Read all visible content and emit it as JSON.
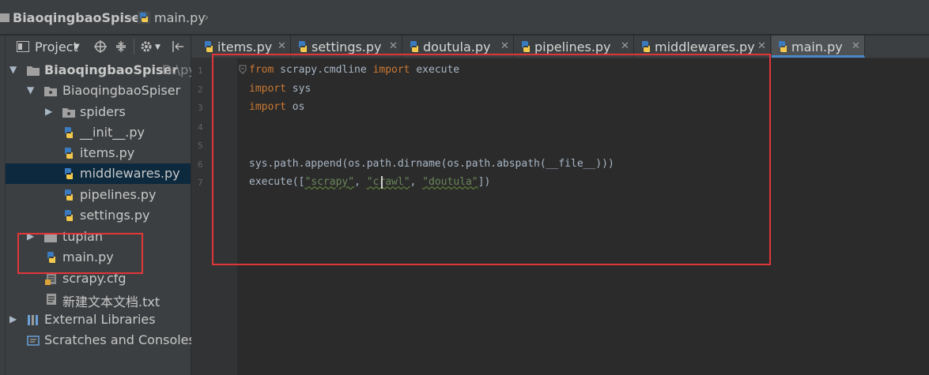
{
  "breadcrumb": {
    "project": "BiaoqingbaoSpiser",
    "file": "main.py"
  },
  "project_toolbar": {
    "title": "Project"
  },
  "tree": {
    "root": {
      "name": "BiaoqingbaoSpiser",
      "path": "D:\\py"
    },
    "package": "BiaoqingbaoSpiser",
    "spiders": "spiders",
    "init": "__init__.py",
    "items": "items.py",
    "middlewares": "middlewares.py",
    "pipelines": "pipelines.py",
    "settings": "settings.py",
    "tuplan": "tuplan",
    "main": "main.py",
    "scrapy_cfg": "scrapy.cfg",
    "txt": "新建文本文档.txt",
    "external": "External Libraries",
    "scratches": "Scratches and Consoles"
  },
  "tabs": [
    "items.py",
    "settings.py",
    "doutula.py",
    "pipelines.py",
    "middlewares.py",
    "main.py"
  ],
  "active_tab": "main.py",
  "editor": {
    "line_numbers": [
      "1",
      "2",
      "3",
      "4",
      "5",
      "6",
      "7"
    ],
    "l1": {
      "kw1": "from",
      "mid": " scrapy.cmdline ",
      "kw2": "import",
      "end": " execute"
    },
    "l2": {
      "kw": "import",
      "end": " sys"
    },
    "l3": {
      "kw": "import",
      "end": " os"
    },
    "l6": "sys.path.append(os.path.dirname(os.path.abspath(__file__)))",
    "l7": {
      "start": "execute([",
      "s1": "\"scrapy\"",
      "sep1": ", ",
      "s2": "\"crawl\"",
      "sep2": ", ",
      "s3": "\"doutula\"",
      "end": "])"
    }
  },
  "colors": {
    "keyword": "#cc7832",
    "string": "#6a8759",
    "annotation_red": "#e0363a",
    "selection": "#0d293e"
  }
}
